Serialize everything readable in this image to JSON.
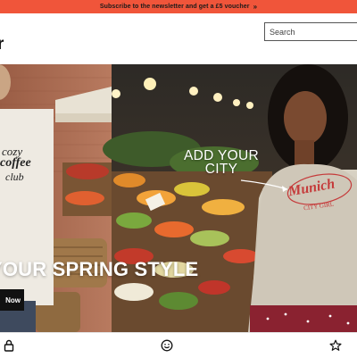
{
  "promo": {
    "text": "Subscribe to the newsletter and get a £5 voucher",
    "chevron": "»",
    "background": "#f0553a"
  },
  "header": {
    "logo_fragment": "r",
    "search": {
      "placeholder": "Search",
      "value": ""
    }
  },
  "hero": {
    "headline": "YOUR SPRING STYLE",
    "cta_label": "Now",
    "callout": "ADD YOUR CITY",
    "tee_left_lines": [
      "cozy",
      "coffee",
      "club"
    ],
    "tee_right_title": "Munich",
    "tee_right_subtitle": "CITY GIRL"
  },
  "bottom_nav": {
    "items": [
      {
        "icon": "lock-icon"
      },
      {
        "icon": "smiley-icon"
      },
      {
        "icon": "star-icon"
      }
    ]
  },
  "colors": {
    "accent": "#f0553a",
    "tee_print": "#c53a3a",
    "cta_background": "#111111"
  }
}
